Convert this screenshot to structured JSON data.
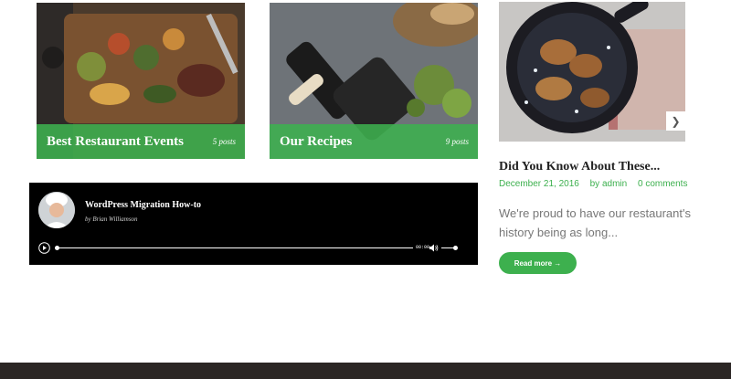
{
  "categories": [
    {
      "title": "Best Restaurant Events",
      "count": "5 posts"
    },
    {
      "title": "Our Recipes",
      "count": "9 posts"
    }
  ],
  "audio": {
    "title": "WordPress Migration How-to",
    "author": "by Brian Williamson",
    "time": "00:00"
  },
  "post": {
    "title": "Did You Know About These...",
    "date": "December 21, 2016",
    "author": "by admin",
    "comments": "0 comments",
    "excerpt": "We're proud to have our restaurant's history being as long...",
    "read_more": "Read more →",
    "next_icon": "chevron-right-icon"
  },
  "colors": {
    "accent": "#3db04e",
    "footer": "#2b2624"
  }
}
